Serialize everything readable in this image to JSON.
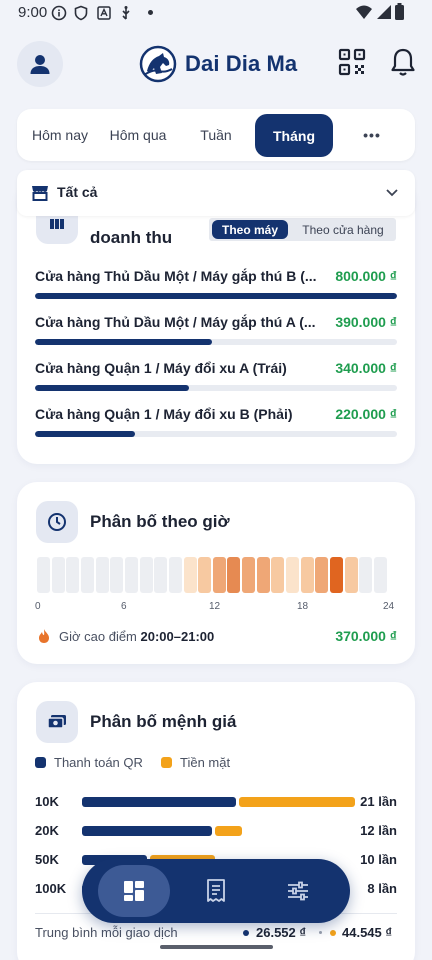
{
  "status_bar": {
    "time": "9:00"
  },
  "header": {
    "app_name": "Dai Dia Ma"
  },
  "tabs": [
    {
      "label": "Hôm nay",
      "active": false
    },
    {
      "label": "Hôm qua",
      "active": false
    },
    {
      "label": "Tuần",
      "active": false
    },
    {
      "label": "Tháng",
      "active": true
    },
    {
      "label": "•••",
      "active": false
    }
  ],
  "store_filter": {
    "selected": "Tất cả"
  },
  "revenue_card": {
    "title": "doanh thu",
    "toggle": {
      "by_machine": "Theo máy",
      "by_store": "Theo cửa hàng",
      "selected": "Theo máy"
    },
    "rows": [
      {
        "name": "Cửa hàng Thủ Dầu Một / Máy gắp thú B (...",
        "value": "800.000 ₫",
        "fraction": 1.0
      },
      {
        "name": "Cửa hàng Thủ Dầu Một / Máy gắp thú A (...",
        "value": "390.000 ₫",
        "fraction": 0.49
      },
      {
        "name": "Cửa hàng Quận 1 / Máy đổi xu A (Trái)",
        "value": "340.000 ₫",
        "fraction": 0.425
      },
      {
        "name": "Cửa hàng Quận 1 / Máy đổi xu B (Phải)",
        "value": "220.000 ₫",
        "fraction": 0.275
      }
    ]
  },
  "hourly_card": {
    "title": "Phân bố theo giờ",
    "ticks": [
      "0",
      "6",
      "12",
      "18",
      "24"
    ],
    "intensity": [
      0,
      0,
      0,
      0,
      0,
      0,
      0,
      0,
      0,
      0,
      1,
      2,
      3,
      4,
      3,
      3,
      2,
      1,
      2,
      3,
      5,
      2,
      0,
      0
    ],
    "colors": [
      "#eceef2",
      "#fbe3cb",
      "#f7c9a1",
      "#efa776",
      "#e68a52",
      "#e06520"
    ],
    "peak_label": "Giờ cao điểm",
    "peak_range": "20:00–21:00",
    "peak_value": "370.000 ₫"
  },
  "denomination_card": {
    "title": "Phân bố mệnh giá",
    "legend": {
      "qr": "Thanh toán QR",
      "cash": "Tiền mặt"
    },
    "colors": {
      "qr": "#14336f",
      "cash": "#f3a21a"
    },
    "rows": [
      {
        "label": "10K",
        "qr": 0.57,
        "cash": 0.43,
        "count": "21 lần"
      },
      {
        "label": "20K",
        "qr": 0.48,
        "cash": 0.1,
        "count": "12 lần"
      },
      {
        "label": "50K",
        "qr": 0.24,
        "cash": 0.24,
        "count": "10 lần"
      },
      {
        "label": "100K",
        "qr": 0.2,
        "cash": 0.2,
        "count": "8 lần"
      }
    ],
    "average_label": "Trung bình mỗi giao dịch",
    "average_qr": "26.552 ₫",
    "average_cash": "44.545 ₫"
  },
  "bottom_nav": {
    "items": [
      "dashboard",
      "receipt",
      "settings"
    ],
    "active": 0
  }
}
